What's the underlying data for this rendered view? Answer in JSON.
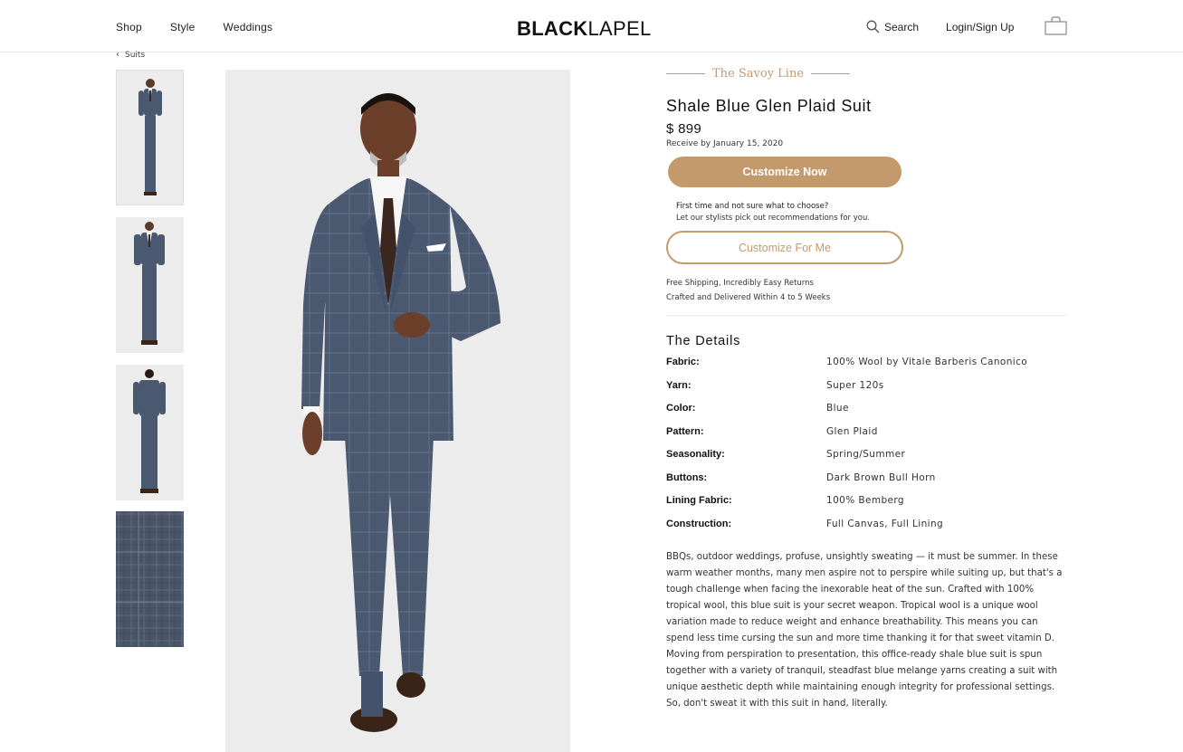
{
  "nav": {
    "left": [
      "Shop",
      "Style",
      "Weddings"
    ],
    "logo_bold": "BLACK",
    "logo_light": "LAPEL",
    "search": "Search",
    "login": "Login/Sign Up",
    "icons": [
      "search-icon",
      "shopping-bag-icon"
    ]
  },
  "breadcrumb": {
    "label": "Suits",
    "icon": "chevron-left-icon"
  },
  "product": {
    "line": "The Savoy Line",
    "title": "Shale Blue Glen Plaid Suit",
    "price": "$ 899",
    "receive_label": "Receive by",
    "receive_date": "January 15, 2020",
    "cta_primary": "Customize Now",
    "stylist_q1": "First time and not sure what to choose?",
    "stylist_q2": "Let our stylists pick out recommendations for you.",
    "cta_secondary": "Customize For Me",
    "ship1": "Free Shipping, Incredibly Easy Returns",
    "ship2": "Crafted and Delivered Within 4 to 5 Weeks",
    "details_heading": "The Details",
    "specs": [
      {
        "k": "Fabric:",
        "v": "100% Wool by Vitale Barberis Canonico"
      },
      {
        "k": "Yarn:",
        "v": "Super 120s"
      },
      {
        "k": "Color:",
        "v": "Blue"
      },
      {
        "k": "Pattern:",
        "v": "Glen Plaid"
      },
      {
        "k": "Seasonality:",
        "v": "Spring/Summer"
      },
      {
        "k": "Buttons:",
        "v": "Dark Brown Bull Horn"
      },
      {
        "k": "Lining Fabric:",
        "v": "100% Bemberg"
      },
      {
        "k": "Construction:",
        "v": "Full Canvas, Full Lining"
      }
    ],
    "description": "BBQs, outdoor weddings, profuse, unsightly sweating — it must be summer. In these warm weather months, many men aspire not to perspire while suiting up, but that's a tough challenge when facing the inexorable heat of the sun. Crafted with 100% tropical wool, this blue suit is your secret weapon. Tropical wool is a unique wool variation made to reduce weight and enhance breathability. This means you can spend less time cursing the sun and more time thanking it for that sweet vitamin D. Moving from perspiration to presentation, this office-ready shale blue suit is spun together with a variety of tranquil, steadfast blue melange yarns creating a suit with unique aesthetic depth while maintaining enough integrity for professional settings. So, don't sweat it with this suit in hand, literally."
  },
  "colors": {
    "accent": "#c49a6c",
    "suit": "#4a5870",
    "image_bg": "#ececec"
  }
}
